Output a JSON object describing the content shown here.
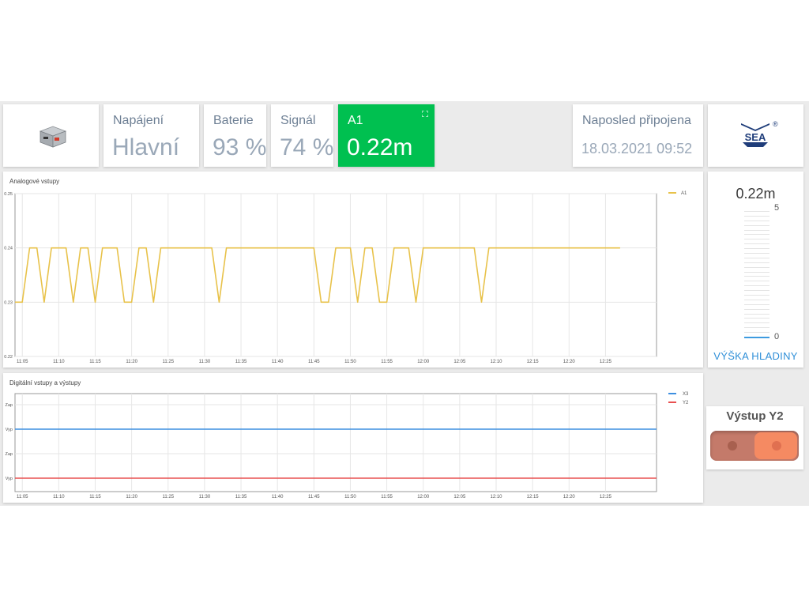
{
  "stats": {
    "power_label": "Napájení",
    "power_value": "Hlavní",
    "battery_label": "Baterie",
    "battery_value": "93 %",
    "signal_label": "Signál",
    "signal_value": "74 %",
    "a1_label": "A1",
    "a1_value": "0.22m",
    "last_label": "Naposled připojena",
    "last_value": "18.03.2021 09:52"
  },
  "logo": {
    "text": "SEA",
    "mark": "®"
  },
  "level": {
    "value": "0.22m",
    "max": "5",
    "min": "0",
    "caption": "VÝŠKA HLADINY",
    "fraction": 0.044
  },
  "output": {
    "title": "Výstup Y2"
  },
  "colors": {
    "accent_green": "#00c050",
    "a1_line": "#e8c24a",
    "x3_line": "#3d8fe0",
    "y2_line": "#e85050",
    "level_blue": "#2f8fd8"
  },
  "chart_data": [
    {
      "type": "line",
      "title": "Analogové vstupy",
      "x_ticks": [
        "11:05",
        "11:10",
        "11:15",
        "11:20",
        "11:25",
        "11:30",
        "11:35",
        "11:40",
        "11:45",
        "11:50",
        "11:55",
        "12:00",
        "12:05",
        "12:10",
        "12:15",
        "12:20",
        "12:25"
      ],
      "y_ticks": [
        "0.25",
        "0.24",
        "0.23",
        "0.22"
      ],
      "xlim": [
        "11:04",
        "12:32"
      ],
      "ylim": [
        0.22,
        0.25
      ],
      "grid": true,
      "legend": "top-right",
      "series": [
        {
          "name": "A1",
          "points": [
            [
              "11:04",
              0.23
            ],
            [
              "11:05",
              0.23
            ],
            [
              "11:06",
              0.24
            ],
            [
              "11:07",
              0.24
            ],
            [
              "11:08",
              0.23
            ],
            [
              "11:09",
              0.24
            ],
            [
              "11:11",
              0.24
            ],
            [
              "11:12",
              0.23
            ],
            [
              "11:13",
              0.24
            ],
            [
              "11:14",
              0.24
            ],
            [
              "11:15",
              0.23
            ],
            [
              "11:16",
              0.24
            ],
            [
              "11:18",
              0.24
            ],
            [
              "11:19",
              0.23
            ],
            [
              "11:20",
              0.23
            ],
            [
              "11:21",
              0.24
            ],
            [
              "11:22",
              0.24
            ],
            [
              "11:23",
              0.23
            ],
            [
              "11:24",
              0.24
            ],
            [
              "11:31",
              0.24
            ],
            [
              "11:32",
              0.23
            ],
            [
              "11:33",
              0.24
            ],
            [
              "11:45",
              0.24
            ],
            [
              "11:46",
              0.23
            ],
            [
              "11:47",
              0.23
            ],
            [
              "11:48",
              0.24
            ],
            [
              "11:50",
              0.24
            ],
            [
              "11:51",
              0.23
            ],
            [
              "11:52",
              0.24
            ],
            [
              "11:53",
              0.24
            ],
            [
              "11:54",
              0.23
            ],
            [
              "11:55",
              0.23
            ],
            [
              "11:56",
              0.24
            ],
            [
              "11:58",
              0.24
            ],
            [
              "11:59",
              0.23
            ],
            [
              "12:00",
              0.24
            ],
            [
              "12:07",
              0.24
            ],
            [
              "12:08",
              0.23
            ],
            [
              "12:09",
              0.24
            ],
            [
              "12:27",
              0.24
            ]
          ]
        }
      ]
    },
    {
      "type": "line",
      "title": "Digitální vstupy a výstupy",
      "x_ticks": [
        "11:05",
        "11:10",
        "11:15",
        "11:20",
        "11:25",
        "11:30",
        "11:35",
        "11:40",
        "11:45",
        "11:50",
        "11:55",
        "12:00",
        "12:05",
        "12:10",
        "12:15",
        "12:20",
        "12:25"
      ],
      "y_ticks": [
        "Zap",
        "Vyp",
        "Zap",
        "Vyp"
      ],
      "xlim": [
        "11:04",
        "12:32"
      ],
      "grid": true,
      "legend": "top-right",
      "series": [
        {
          "name": "X3",
          "state": "Vyp"
        },
        {
          "name": "Y2",
          "state": "Vyp"
        }
      ]
    }
  ]
}
